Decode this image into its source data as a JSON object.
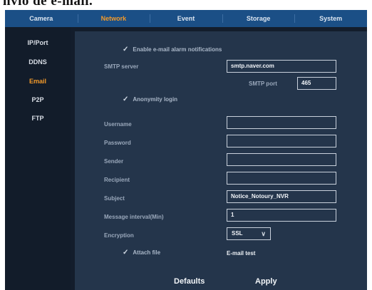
{
  "caption": {
    "text": "nvio de e-mail."
  },
  "nav": {
    "tabs": [
      {
        "label": "Camera"
      },
      {
        "label": "Network"
      },
      {
        "label": "Event"
      },
      {
        "label": "Storage"
      },
      {
        "label": "System"
      }
    ],
    "active": "Network",
    "active_color": "#f39a2a"
  },
  "sidebar": {
    "items": [
      {
        "label": "IP/Port"
      },
      {
        "label": "DDNS"
      },
      {
        "label": "Email"
      },
      {
        "label": "P2P"
      },
      {
        "label": "FTP"
      }
    ],
    "active": "Email"
  },
  "form": {
    "enable_notifications": {
      "label": "Enable e-mail alarm notifications",
      "checked": true
    },
    "smtp_server": {
      "label": "SMTP server",
      "value": "smtp.naver.com"
    },
    "smtp_port": {
      "label": "SMTP port",
      "value": "465"
    },
    "anonymity_login": {
      "label": "Anonymity login",
      "checked": true
    },
    "username": {
      "label": "Username",
      "value": ""
    },
    "password": {
      "label": "Password",
      "value": ""
    },
    "sender": {
      "label": "Sender",
      "value": ""
    },
    "recipient": {
      "label": "Recipient",
      "value": ""
    },
    "subject": {
      "label": "Subject",
      "value": "Notice_Notoury_NVR"
    },
    "message_interval": {
      "label": "Message interval(Min)",
      "value": "1"
    },
    "encryption": {
      "label": "Encryption",
      "value": "SSL"
    },
    "attach_file": {
      "label": "Attach file",
      "checked": true
    },
    "email_test": {
      "label": "E-mail test"
    }
  },
  "buttons": {
    "defaults": "Defaults",
    "apply": "Apply"
  },
  "colors": {
    "nav_bar": "#1b4f86",
    "panel": "#24354b",
    "background": "#131d2c"
  }
}
